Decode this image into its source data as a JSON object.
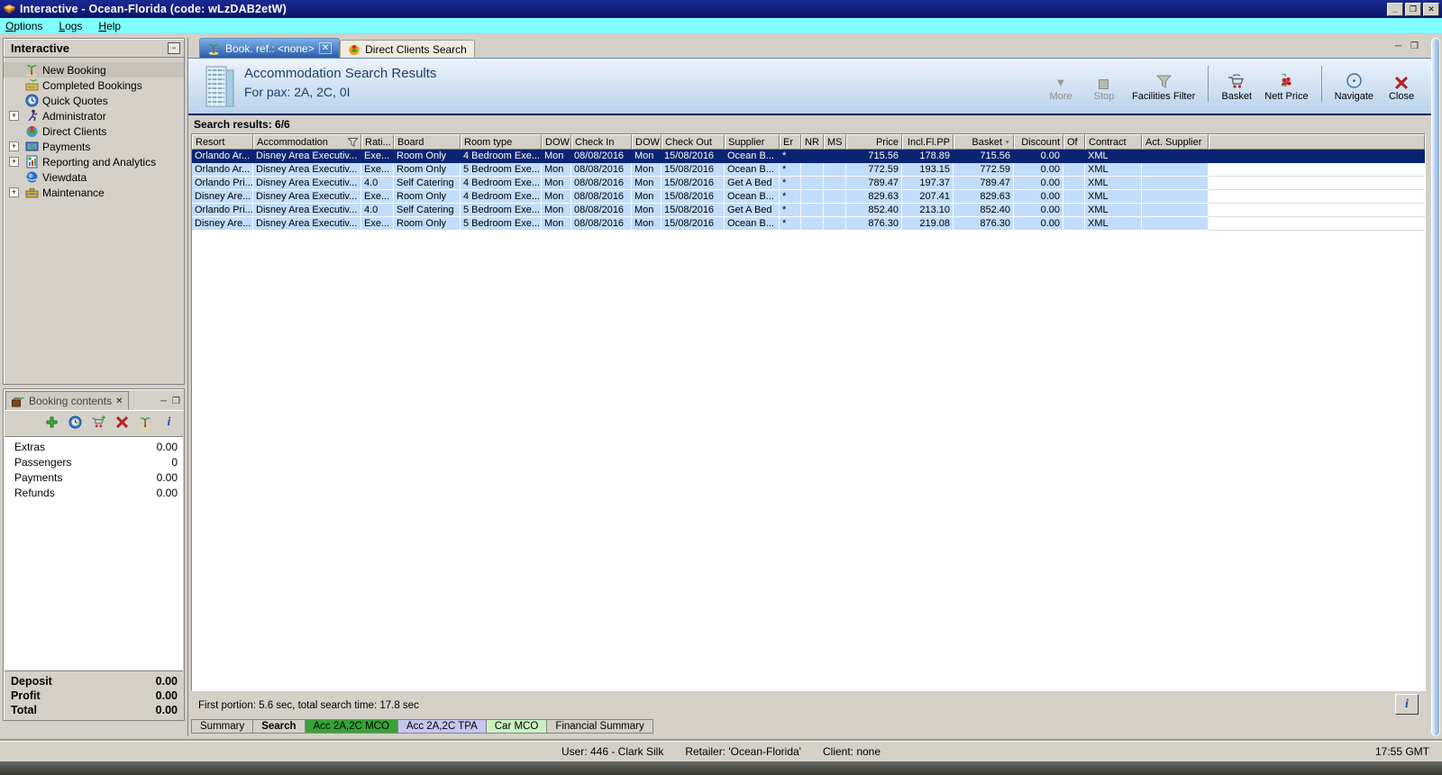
{
  "window": {
    "title": "Interactive - Ocean-Florida (code: wLzDAB2etW)"
  },
  "icons": {
    "minimize": "_",
    "restore": "❐",
    "close": "✕",
    "collapse": "−",
    "expand": "+",
    "panel_min": "─",
    "panel_max": "❒",
    "tab_close": "✕",
    "sort_desc": "▼",
    "more_glyph": "▼",
    "info": "i"
  },
  "menu": {
    "items": [
      {
        "label": "Options"
      },
      {
        "label": "Logs"
      },
      {
        "label": "Help"
      }
    ]
  },
  "sidebar": {
    "title": "Interactive",
    "items": [
      {
        "label": "New Booking",
        "icon": "palm-tree",
        "selected": true,
        "expandable": false
      },
      {
        "label": "Completed Bookings",
        "icon": "money-palm",
        "selected": false,
        "expandable": false
      },
      {
        "label": "Quick Quotes",
        "icon": "clock-globe",
        "selected": false,
        "expandable": false
      },
      {
        "label": "Administrator",
        "icon": "runner",
        "selected": false,
        "expandable": true
      },
      {
        "label": "Direct Clients",
        "icon": "globe-people",
        "selected": false,
        "expandable": false
      },
      {
        "label": "Payments",
        "icon": "money",
        "selected": false,
        "expandable": true
      },
      {
        "label": "Reporting and Analytics",
        "icon": "report",
        "selected": false,
        "expandable": true
      },
      {
        "label": "Viewdata",
        "icon": "disc-globe",
        "selected": false,
        "expandable": false
      },
      {
        "label": "Maintenance",
        "icon": "toolbox",
        "selected": false,
        "expandable": true
      }
    ]
  },
  "booking": {
    "title": "Booking contents",
    "toolbar": [
      "add",
      "quick-quote",
      "transfer-basket",
      "delete",
      "holiday",
      "info"
    ],
    "rows": [
      {
        "label": "Extras",
        "value": "0.00"
      },
      {
        "label": "Passengers",
        "value": "0"
      },
      {
        "label": "Payments",
        "value": "0.00"
      },
      {
        "label": "Refunds",
        "value": "0.00"
      }
    ],
    "totals": [
      {
        "label": "Deposit",
        "value": "0.00"
      },
      {
        "label": "Profit",
        "value": "0.00"
      },
      {
        "label": "Total",
        "value": "0.00"
      }
    ]
  },
  "main": {
    "tabs": [
      {
        "label": "Book. ref.: <none>",
        "active": true
      },
      {
        "label": "Direct Clients Search",
        "active": false
      }
    ],
    "header": {
      "title": "Accommodation Search Results",
      "subtitle": "For pax: 2A, 2C, 0I"
    },
    "toolbar": [
      {
        "label": "More",
        "disabled": true
      },
      {
        "label": "Stop",
        "disabled": true
      },
      {
        "label": "Facilities Filter",
        "disabled": false
      },
      {
        "label": "Basket",
        "disabled": false
      },
      {
        "label": "Nett Price",
        "disabled": false
      },
      {
        "label": "Navigate",
        "disabled": false
      },
      {
        "label": "Close",
        "disabled": false
      }
    ],
    "results_label": "Search results: 6/6",
    "table": {
      "columns": [
        "Resort",
        "Accommodation",
        "Rati...",
        "Board",
        "Room type",
        "DOW",
        "Check In",
        "DOW",
        "Check Out",
        "Supplier",
        "Er",
        "NR",
        "MS",
        "Price",
        "Incl.Fl.PP",
        "Basket",
        "Discount",
        "Of",
        "Contract",
        "Act. Supplier"
      ],
      "rows": [
        [
          "Orlando Ar...",
          "Disney Area Executiv...",
          "Exe...",
          "Room Only",
          "4 Bedroom Exe...",
          "Mon",
          "08/08/2016",
          "Mon",
          "15/08/2016",
          "Ocean B...",
          "*",
          "",
          "",
          "715.56",
          "178.89",
          "715.56",
          "0.00",
          "",
          "XML",
          ""
        ],
        [
          "Orlando Ar...",
          "Disney Area Executiv...",
          "Exe...",
          "Room Only",
          "5 Bedroom Exe...",
          "Mon",
          "08/08/2016",
          "Mon",
          "15/08/2016",
          "Ocean B...",
          "*",
          "",
          "",
          "772.59",
          "193.15",
          "772.59",
          "0.00",
          "",
          "XML",
          ""
        ],
        [
          "Orlando Pri...",
          "Disney Area Executiv...",
          "4.0",
          "Self Catering",
          "4 Bedroom Exe...",
          "Mon",
          "08/08/2016",
          "Mon",
          "15/08/2016",
          "Get A Bed",
          "*",
          "",
          "",
          "789.47",
          "197.37",
          "789.47",
          "0.00",
          "",
          "XML",
          ""
        ],
        [
          "Disney Are...",
          "Disney Area Executiv...",
          "Exe...",
          "Room Only",
          "4 Bedroom Exe...",
          "Mon",
          "08/08/2016",
          "Mon",
          "15/08/2016",
          "Ocean B...",
          "*",
          "",
          "",
          "829.63",
          "207.41",
          "829.63",
          "0.00",
          "",
          "XML",
          ""
        ],
        [
          "Orlando Pri...",
          "Disney Area Executiv...",
          "4.0",
          "Self Catering",
          "5 Bedroom Exe...",
          "Mon",
          "08/08/2016",
          "Mon",
          "15/08/2016",
          "Get A Bed",
          "*",
          "",
          "",
          "852.40",
          "213.10",
          "852.40",
          "0.00",
          "",
          "XML",
          ""
        ],
        [
          "Disney Are...",
          "Disney Area Executiv...",
          "Exe...",
          "Room Only",
          "5 Bedroom Exe...",
          "Mon",
          "08/08/2016",
          "Mon",
          "15/08/2016",
          "Ocean B...",
          "*",
          "",
          "",
          "876.30",
          "219.08",
          "876.30",
          "0.00",
          "",
          "XML",
          ""
        ]
      ],
      "selected_row_index": 0
    },
    "status_text": "First portion: 5.6 sec, total search time: 17.8 sec",
    "bottom_tabs": [
      {
        "label": "Summary"
      },
      {
        "label": "Search",
        "emphasis": true
      },
      {
        "label": "Acc 2A,2C MCO",
        "color": "#35a435"
      },
      {
        "label": "Acc 2A,2C TPA",
        "color": "#c6c6f2"
      },
      {
        "label": "Car MCO",
        "color": "#c9f2c2"
      },
      {
        "label": "Financial Summary"
      }
    ]
  },
  "statusbar": {
    "user": "User: 446 - Clark Silk",
    "retailer": "Retailer: 'Ocean-Florida'",
    "client": "Client: none",
    "time": "17:55 GMT"
  },
  "colors": {
    "titlebar": "#0d1668",
    "menubar": "#80ffff",
    "chrome": "#d4d0c8",
    "row_blue": "#c2ddfb",
    "row_selected": "#0a2472",
    "active_tab": "#2a5ca8"
  }
}
